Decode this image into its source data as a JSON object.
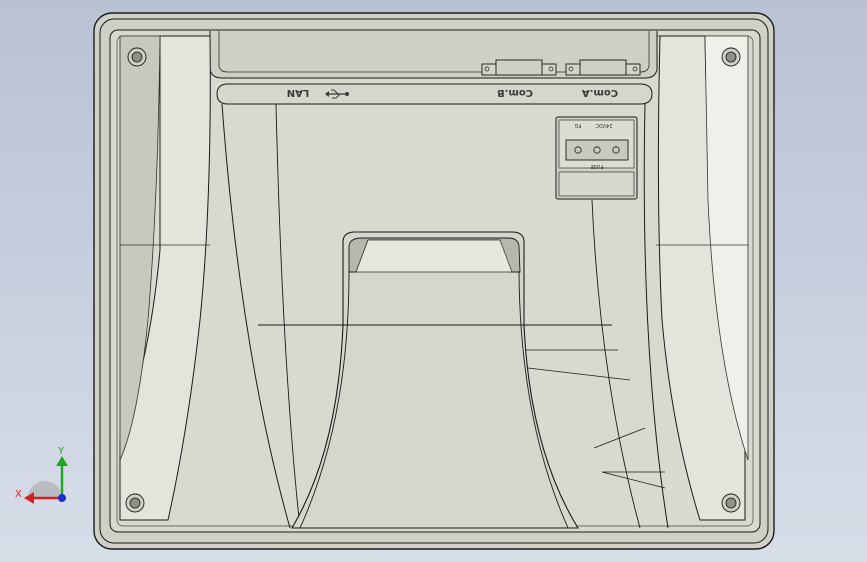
{
  "device": {
    "name": "",
    "port_labels": {
      "lan": "LAN",
      "usb": "usb-icon",
      "com_b": "Com.B",
      "com_a": "Com.A"
    },
    "power_connector": {
      "voltage": "24VDC",
      "fg": "FG",
      "fuse": "FUSE"
    }
  },
  "triad": {
    "x_label": "X",
    "y_label": "Y",
    "colors": {
      "x": "#d32020",
      "y": "#1fa81f",
      "z": "#1830c8"
    }
  },
  "colors": {
    "body": "#d9d9d0",
    "frame": "#d2d2c8",
    "outline": "#1a1a1a",
    "background_top": "#b8c2d4"
  }
}
